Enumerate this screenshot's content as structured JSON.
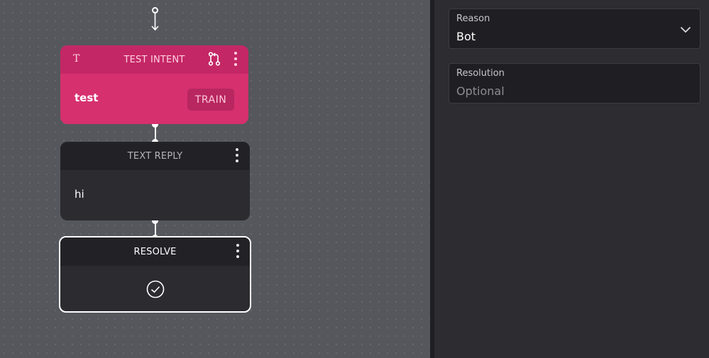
{
  "flow": {
    "intent_card": {
      "type_glyph": "T",
      "title": "TEST INTENT",
      "phrase": "test",
      "train_label": "TRAIN",
      "accent": "#d6306f"
    },
    "reply_card": {
      "title": "TEXT REPLY",
      "message": "hi"
    },
    "resolve_card": {
      "title": "RESOLVE"
    }
  },
  "panel": {
    "reason": {
      "label": "Reason",
      "value": "Bot"
    },
    "resolution": {
      "label": "Resolution",
      "placeholder": "Optional"
    }
  },
  "icons": [
    "branch-icon",
    "kebab-menu-icon",
    "checkmark-circle-icon",
    "chevron-down-icon",
    "arrow-down-icon"
  ]
}
